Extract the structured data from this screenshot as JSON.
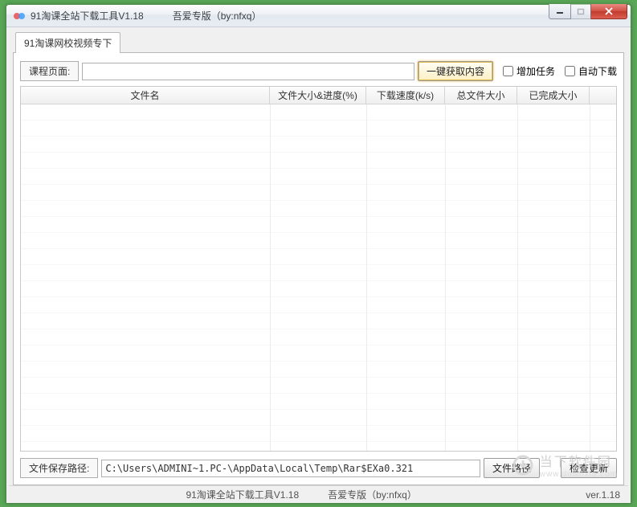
{
  "window": {
    "title": "91淘课全站下载工具V1.18　　　吾爱专版（by:nfxq）"
  },
  "tab": {
    "label": "91淘课网校视频专下"
  },
  "course": {
    "label": "课程页面:",
    "value": "",
    "fetch_button": "一键获取内容",
    "add_task_label": "增加任务",
    "auto_download_label": "自动下载"
  },
  "table": {
    "headers": {
      "filename": "文件名",
      "size_progress": "文件大小&进度(%)",
      "speed": "下载速度(k/s)",
      "total_size": "总文件大小",
      "done_size": "已完成大小"
    }
  },
  "save": {
    "label": "文件保存路径:",
    "value": "C:\\Users\\ADMINI~1.PC-\\AppData\\Local\\Temp\\Rar$EXa0.321",
    "browse_button": "文件路径",
    "check_update_button": "检查更新"
  },
  "status": {
    "center": "91淘课全站下载工具V1.18　　　吾爱专版（by:nfxq）",
    "version": "ver.1.18"
  },
  "watermark": {
    "text": "当下软件园",
    "url": "www.downxia.com"
  }
}
